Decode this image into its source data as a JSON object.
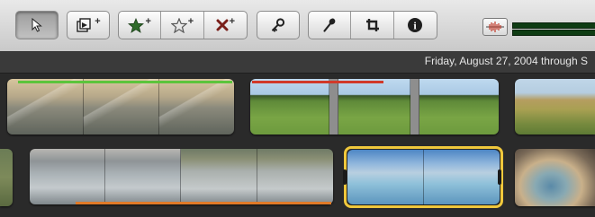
{
  "toolbar": {
    "tools": [
      {
        "name": "arrow-tool",
        "icon": "arrow-pointer-icon",
        "pressed": true
      },
      {
        "name": "add-to-project",
        "icon": "add-clip-icon"
      },
      {
        "name": "mark-favorite",
        "icon": "filled-star-plus-icon"
      },
      {
        "name": "unmark",
        "icon": "outline-star-plus-icon"
      },
      {
        "name": "reject",
        "icon": "x-plus-icon"
      },
      {
        "name": "keyword",
        "icon": "key-icon"
      },
      {
        "name": "voiceover",
        "icon": "microphone-icon"
      },
      {
        "name": "crop",
        "icon": "crop-icon"
      },
      {
        "name": "inspector",
        "icon": "info-icon"
      }
    ],
    "plus_symbol": "+",
    "info_glyph": "i",
    "audio_meter_icon": "waveform-icon"
  },
  "event": {
    "date_range": "Friday, August 27, 2004 through S"
  },
  "colors": {
    "favorite_bar": "#5cc43c",
    "reject_bar": "#d13a2a",
    "used_bar": "#e07a28",
    "selection": "#f0c83c",
    "star_green": "#2f6b2a",
    "x_red": "#7a1f1a"
  },
  "clips": [
    {
      "name": "mountain-clip",
      "scene": "mountain",
      "marker": "favorite",
      "frames": 3
    },
    {
      "name": "prairie-clip",
      "scene": "prairie",
      "marker": "rejected",
      "frames": 3
    },
    {
      "name": "plains-clip",
      "scene": "plain",
      "frames": 1
    },
    {
      "name": "edge-clip",
      "scene": "forest",
      "frames": 1
    },
    {
      "name": "river-clip",
      "scene": "river",
      "marker": "used",
      "frames": 4
    },
    {
      "name": "hot-spring-clip",
      "scene": "spring",
      "selected": true,
      "frames": 2
    },
    {
      "name": "geyser-pool-clip",
      "scene": "pool",
      "frames": 1
    }
  ]
}
